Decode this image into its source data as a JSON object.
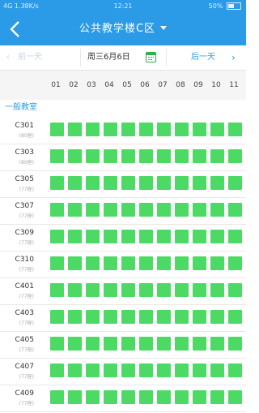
{
  "status_bar": {
    "network": "4G 1.38K/s",
    "time": "12:21",
    "battery": "50%",
    "battery_level": 0.5
  },
  "title_bar": {
    "back_icon": "chevron-left-icon",
    "title": "公共教学楼C区",
    "dropdown_icon": "caret-down-icon"
  },
  "date_nav": {
    "prev_label": "前一天",
    "current_date": "周三6月6日",
    "calendar_icon": "calendar-icon",
    "next_label": "后一天"
  },
  "periods": [
    "01",
    "02",
    "03",
    "04",
    "05",
    "06",
    "07",
    "08",
    "09",
    "10",
    "11"
  ],
  "section_title": "一般教室",
  "rooms": [
    {
      "name": "C301",
      "capacity": "(80座)"
    },
    {
      "name": "C303",
      "capacity": "(80座)"
    },
    {
      "name": "C305",
      "capacity": "(77座)"
    },
    {
      "name": "C307",
      "capacity": "(77座)"
    },
    {
      "name": "C309",
      "capacity": "(77座)"
    },
    {
      "name": "C310",
      "capacity": "(77座)"
    },
    {
      "name": "C401",
      "capacity": "(77座)"
    },
    {
      "name": "C403",
      "capacity": "(77座)"
    },
    {
      "name": "C405",
      "capacity": "(77座)"
    },
    {
      "name": "C407",
      "capacity": "(77座)"
    },
    {
      "name": "C409",
      "capacity": "(77座)"
    }
  ],
  "colors": {
    "primary": "#2b9be8",
    "available": "#4cd964"
  }
}
